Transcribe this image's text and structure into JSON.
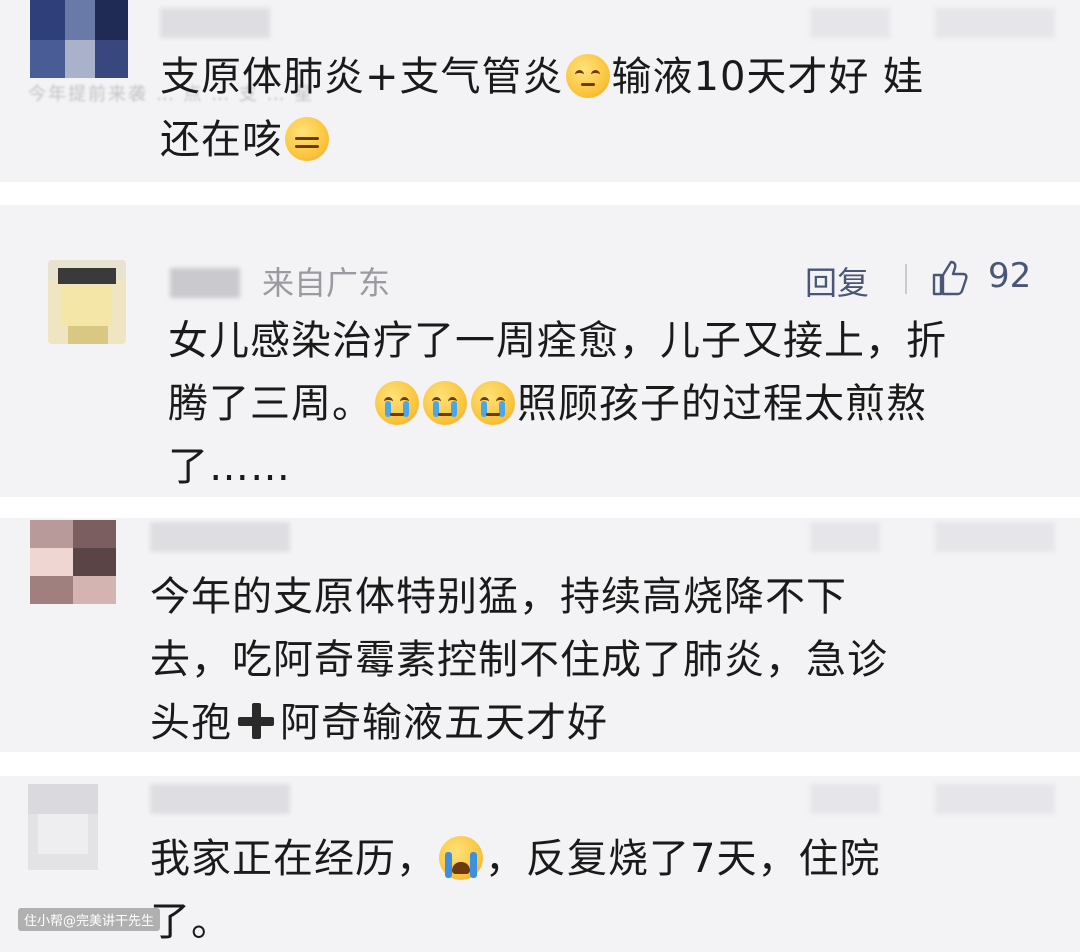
{
  "comments": [
    {
      "text_line1": "支原体肺炎+支气管炎",
      "emoji1": "rolling-eyes-emoji",
      "text_line1b": "输液10天才好 娃",
      "text_line2": "还在咳",
      "emoji2": "speechless-emoji",
      "ghost_text": "今年提前来袭 … 点 … 支 … 星"
    },
    {
      "location": "来自广东",
      "reply_label": "回复",
      "like_count": "92",
      "line1": "女儿感染治疗了一周痊愈，儿子又接上，折",
      "line2_a": "腾了三周。",
      "line2_b": "照顾孩子的过程太煎熬",
      "line3": "了……",
      "emoji": "crying-emoji"
    },
    {
      "line1": "今年的支原体特别猛，持续高烧降不下",
      "line2": "去，吃阿奇霉素控制不住成了肺炎，急诊",
      "line3_a": "头孢",
      "line3_b": "阿奇输液五天才好",
      "icon": "plus-icon"
    },
    {
      "line1_a": "我家正在经历，",
      "line1_b": "，反复烧了7天，住院",
      "line2": "了。",
      "emoji": "sobbing-emoji"
    }
  ],
  "watermark": "住小帮@完美讲干先生",
  "colors": {
    "card_bg": "#f3f3f5",
    "text": "#1a1a1a",
    "meta": "#9a9aa0",
    "link": "#4a5675"
  }
}
